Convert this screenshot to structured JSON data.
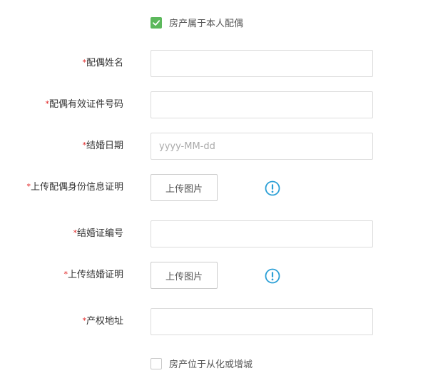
{
  "ownership_checkbox": {
    "label": "房产属于本人配偶",
    "checked": true
  },
  "fields": {
    "spouse_name": {
      "required_mark": "*",
      "label": "配偶姓名",
      "value": ""
    },
    "spouse_id_number": {
      "required_mark": "*",
      "label": "配偶有效证件号码",
      "value": ""
    },
    "marriage_date": {
      "required_mark": "*",
      "label": "结婚日期",
      "value": "",
      "placeholder": "yyyy-MM-dd"
    },
    "spouse_id_upload": {
      "required_mark": "*",
      "label": "上传配偶身份信息证明",
      "button_label": "上传图片",
      "icon": "info-circle-icon"
    },
    "marriage_cert_number": {
      "required_mark": "*",
      "label": "结婚证编号",
      "value": ""
    },
    "marriage_cert_upload": {
      "required_mark": "*",
      "label": "上传结婚证明",
      "button_label": "上传图片",
      "icon": "info-circle-icon"
    },
    "property_address": {
      "required_mark": "*",
      "label": "产权地址",
      "value": ""
    }
  },
  "location_checkbox": {
    "label": "房产位于从化或增城",
    "checked": false
  },
  "colors": {
    "checkbox_checked": "#5cb85c",
    "required_mark": "#e02020",
    "info_icon": "#2a9fd6"
  }
}
